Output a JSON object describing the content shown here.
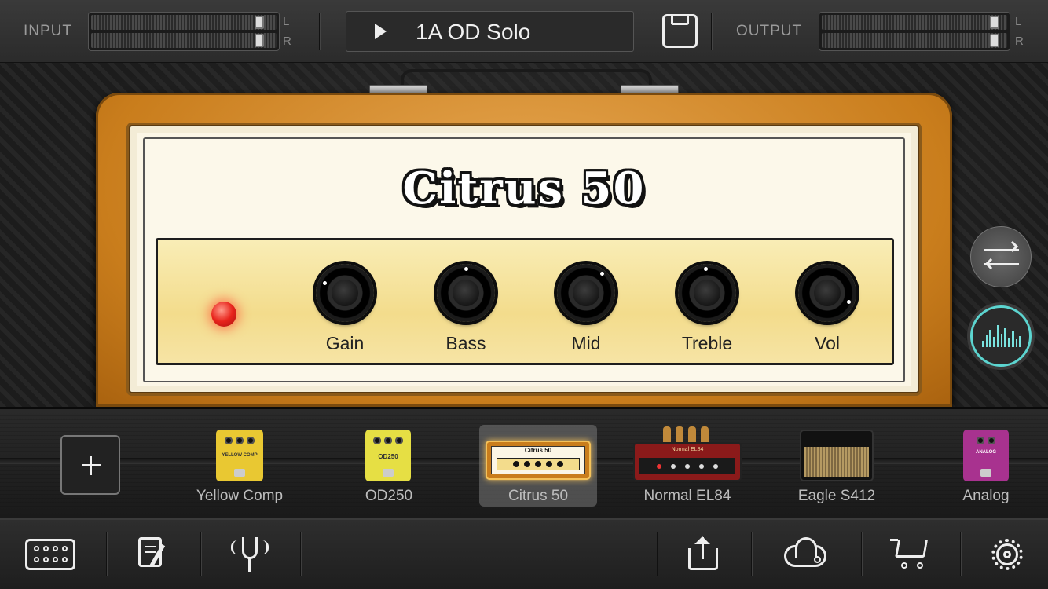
{
  "header": {
    "input_label": "INPUT",
    "output_label": "OUTPUT",
    "channel_left": "L",
    "channel_right": "R",
    "preset_name": "1A OD Solo"
  },
  "amp": {
    "model_name": "Citrus 50",
    "controls": [
      {
        "label": "Gain"
      },
      {
        "label": "Bass"
      },
      {
        "label": "Mid"
      },
      {
        "label": "Treble"
      },
      {
        "label": "Vol"
      }
    ]
  },
  "chain": {
    "items": [
      {
        "label": "Yellow Comp",
        "kind": "pedal",
        "color": "#e9c832"
      },
      {
        "label": "OD250",
        "kind": "pedal",
        "color": "#e6df44"
      },
      {
        "label": "Citrus 50",
        "kind": "amp",
        "selected": true
      },
      {
        "label": "Normal EL84",
        "kind": "amp",
        "color": "#8b1a1a"
      },
      {
        "label": "Eagle S412",
        "kind": "cabinet"
      },
      {
        "label": "Analog",
        "kind": "pedal",
        "color": "#a8328f"
      }
    ]
  },
  "pedal_text": {
    "yellow_comp": "YELLOW COMP",
    "od250": "OD250",
    "citrus_small": "Citrus 50",
    "normal_small": "Normal EL84",
    "analog_small": "ANALOG"
  },
  "icons": {
    "save": "save-icon",
    "swap": "swap-arrows-icon",
    "eq": "equalizer-icon",
    "add": "plus-icon",
    "pedalboard": "pedalboard-icon",
    "notes": "notes-icon",
    "tuner": "tuning-fork-icon",
    "share": "share-icon",
    "cloud": "cloud-share-icon",
    "cart": "cart-icon",
    "settings": "gear-icon"
  },
  "colors": {
    "accent_teal": "#5cd5d0",
    "amp_orange": "#c97d1c",
    "panel_yellow": "#f3dc8c",
    "led_red": "#e8241c"
  }
}
